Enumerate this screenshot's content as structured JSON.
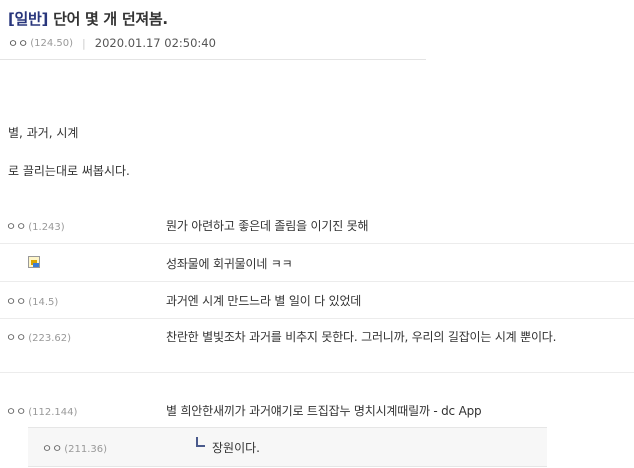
{
  "post": {
    "head": "[일반]",
    "title": "단어 몇 개 던져봄.",
    "writer": {
      "nick": "ㅇㅇ",
      "ip": "(124.50)"
    },
    "date": "2020.01.17 02:50:40",
    "body": [
      "별, 과거, 시계",
      "로 끌리는대로 써봅시다."
    ]
  },
  "comments": [
    {
      "nick": "ㅇㅇ",
      "ip": "(1.243)",
      "text": "뭔가 아련하고 좋은데 졸림을 이기진 못해"
    },
    {
      "nick": "",
      "ip": "",
      "text": "성좌물에 회귀물이네 ㅋㅋ"
    },
    {
      "nick": "ㅇㅇ",
      "ip": "(14.5)",
      "text": "과거엔 시계 만드느라 별 일이 다 있었데"
    },
    {
      "nick": "ㅇㅇ",
      "ip": "(223.62)",
      "text": "찬란한 별빛조차 과거를 비추지 못한다. 그러니까, 우리의 길잡이는 시계 뿐이다."
    },
    {
      "nick": "ㅇㅇ",
      "ip": "(112.144)",
      "text": "별 희안한새끼가 과거얘기로 트집잡누 명치시계때릴까 - dc App"
    }
  ],
  "reply": {
    "nick": "ㅇㅇ",
    "ip": "(211.36)",
    "text": "장원이다."
  },
  "colors": {
    "head": "#29367c",
    "reply_bg": "#f7f7f7",
    "divider": "#ececec"
  }
}
